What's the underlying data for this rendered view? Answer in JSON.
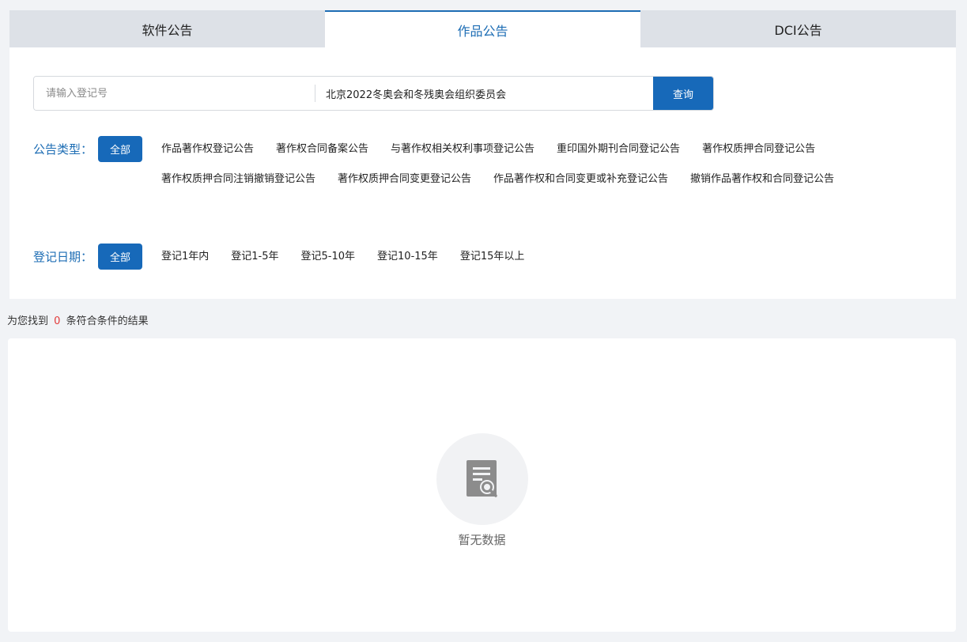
{
  "tabs": [
    {
      "label": "软件公告",
      "active": false
    },
    {
      "label": "作品公告",
      "active": true
    },
    {
      "label": "DCI公告",
      "active": false
    }
  ],
  "search": {
    "reg_placeholder": "请输入登记号",
    "reg_value": "",
    "name_value": "北京2022冬奥会和冬残奥会组织委员会",
    "button_label": "查询"
  },
  "announcement_type": {
    "label": "公告类型：",
    "all_label": "全部",
    "options": [
      "作品著作权登记公告",
      "著作权合同备案公告",
      "与著作权相关权利事项登记公告",
      "重印国外期刊合同登记公告",
      "著作权质押合同登记公告",
      "著作权质押合同注销撤销登记公告",
      "著作权质押合同变更登记公告",
      "作品著作权和合同变更或补充登记公告",
      "撤销作品著作权和合同登记公告"
    ]
  },
  "registration_date": {
    "label": "登记日期：",
    "all_label": "全部",
    "options": [
      "登记1年内",
      "登记1-5年",
      "登记5-10年",
      "登记10-15年",
      "登记15年以上"
    ]
  },
  "results": {
    "prefix": "为您找到",
    "count": "0",
    "suffix": "条符合条件的结果",
    "empty_text": "暂无数据"
  },
  "colors": {
    "accent": "#1769b9",
    "count_red": "#e23b3b"
  },
  "icons": {
    "empty": "document-search-icon"
  }
}
